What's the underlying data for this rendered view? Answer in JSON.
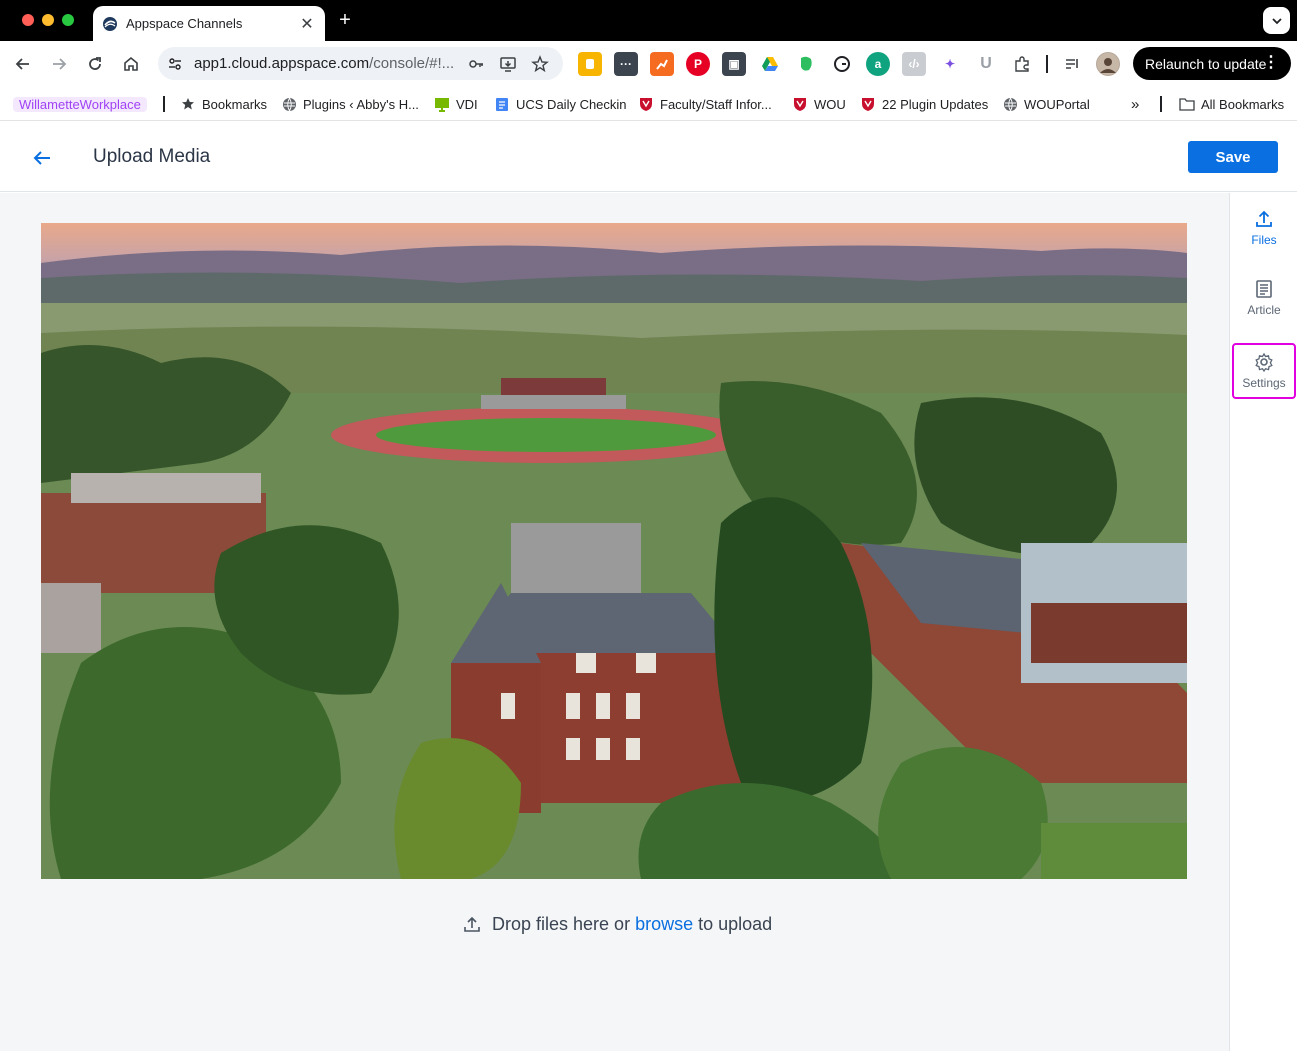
{
  "browser": {
    "tab_title": "Appspace Channels",
    "url_host": "app1.cloud.appspace.com",
    "url_path": "/console/#!...",
    "relaunch_label": "Relaunch to update"
  },
  "bookmarks": [
    {
      "label": "WillametteWorkplace"
    },
    {
      "label": "Bookmarks"
    },
    {
      "label": "Plugins ‹ Abby's H..."
    },
    {
      "label": "VDI"
    },
    {
      "label": "UCS Daily Checkin"
    },
    {
      "label": "Faculty/Staff Infor..."
    },
    {
      "label": "WOU"
    },
    {
      "label": "22 Plugin Updates"
    },
    {
      "label": "WOUPortal"
    },
    {
      "label": "All Bookmarks"
    }
  ],
  "header": {
    "title": "Upload Media",
    "save_label": "Save"
  },
  "dropzone": {
    "prefix": "Drop files here or",
    "link": "browse",
    "suffix": "to upload"
  },
  "rail": {
    "files": "Files",
    "article": "Article",
    "settings": "Settings"
  },
  "colors": {
    "accent": "#0a6fe0",
    "highlight": "#e000e0"
  }
}
